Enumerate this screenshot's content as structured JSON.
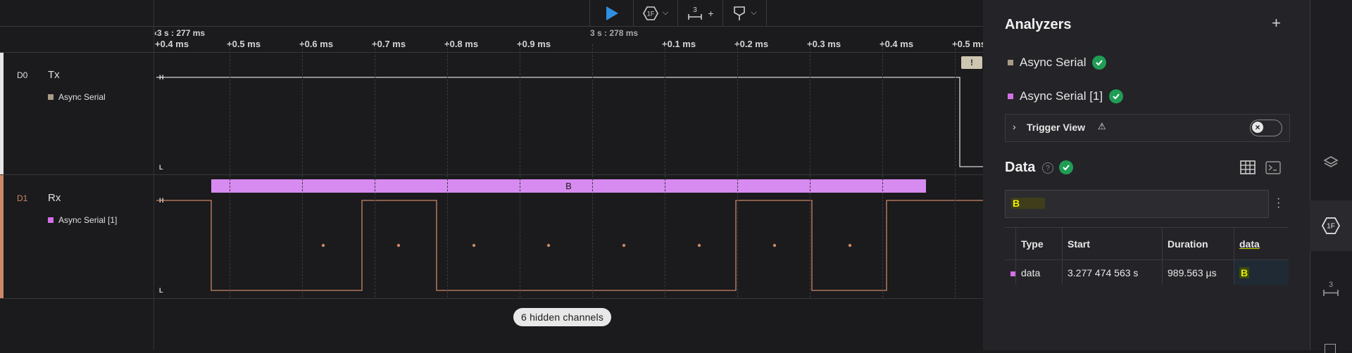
{
  "toolbar": {
    "analyzer_icon_text": "1F",
    "measure_icon_text": "3",
    "measure_add": "+"
  },
  "timeline": {
    "marker_left": "3 s : 277 ms",
    "marker_mid": "3 s : 278 ms",
    "ticks": [
      "+0.4 ms",
      "+0.5 ms",
      "+0.6 ms",
      "+0.7 ms",
      "+0.8 ms",
      "+0.9 ms",
      "+0.1 ms",
      "+0.2 ms",
      "+0.3 ms",
      "+0.4 ms",
      "+0.5 ms"
    ]
  },
  "channels": [
    {
      "id": "D0",
      "name": "Tx",
      "analyzer": "Async Serial",
      "color": "#a89c86",
      "high": "H",
      "low": "L"
    },
    {
      "id": "D1",
      "name": "Rx",
      "analyzer": "Async Serial [1]",
      "color": "#c98866",
      "high": "H",
      "low": "L"
    }
  ],
  "decoded_frame": {
    "text": "B",
    "color": "#d78af0"
  },
  "alert_marker": "!",
  "hidden_channels": "6 hidden channels",
  "panel": {
    "analyzers_title": "Analyzers",
    "add": "+",
    "analyzers": [
      {
        "name": "Async Serial",
        "color": "#a89c86"
      },
      {
        "name": "Async Serial [1]",
        "color": "#d46fe6"
      }
    ],
    "trigger_view": "Trigger View",
    "trigger_warning": "⚠",
    "data_title": "Data",
    "help": "?",
    "search_value": "B",
    "table": {
      "headers": [
        "Type",
        "Start",
        "Duration",
        "data"
      ],
      "rows": [
        {
          "type": "data",
          "start": "3.277 474 563 s",
          "duration": "989.563 µs",
          "data": "B"
        }
      ]
    }
  },
  "rail": {
    "analyzer_icon_text": "1F",
    "measure_icon_text": "3"
  },
  "colors": {
    "accent_play": "#2f8fe0",
    "check_green": "#1f9d55",
    "frame_purple": "#d78af0",
    "highlight_yellow": "#d8f000"
  }
}
